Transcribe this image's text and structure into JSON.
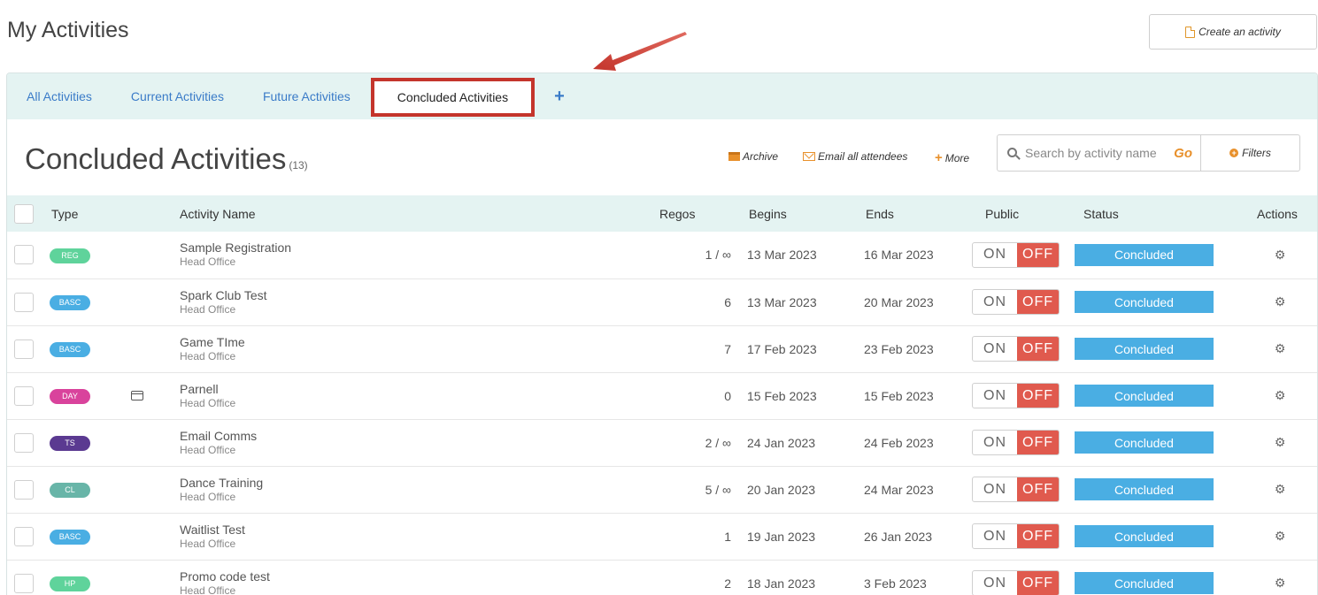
{
  "page": {
    "title": "My Activities"
  },
  "create_button": {
    "label": "Create an activity"
  },
  "tabs": [
    {
      "label": "All Activities"
    },
    {
      "label": "Current Activities"
    },
    {
      "label": "Future Activities"
    },
    {
      "label": "Concluded Activities",
      "active": true
    }
  ],
  "section": {
    "title": "Concluded Activities",
    "count": "(13)"
  },
  "toolbar": {
    "archive": "Archive",
    "email": "Email all attendees",
    "more": "More"
  },
  "search": {
    "placeholder": "Search by activity name",
    "go": "Go",
    "filters": "Filters"
  },
  "table": {
    "headers": {
      "type": "Type",
      "name": "Activity Name",
      "regos": "Regos",
      "begins": "Begins",
      "ends": "Ends",
      "public": "Public",
      "status": "Status",
      "actions": "Actions"
    },
    "rows": [
      {
        "type": "REG",
        "type_color": "#5fd39b",
        "card": false,
        "name": "Sample Registration",
        "location": "Head Office",
        "regos": "1 / ∞",
        "begins": "13 Mar 2023",
        "ends": "16 Mar 2023",
        "on": "ON",
        "off": "OFF",
        "status": "Concluded"
      },
      {
        "type": "BASC",
        "type_color": "#4aaee3",
        "card": false,
        "name": "Spark Club Test",
        "location": "Head Office",
        "regos": "6",
        "begins": "13 Mar 2023",
        "ends": "20 Mar 2023",
        "on": "ON",
        "off": "OFF",
        "status": "Concluded"
      },
      {
        "type": "BASC",
        "type_color": "#4aaee3",
        "card": false,
        "name": "Game TIme",
        "location": "Head Office",
        "regos": "7",
        "begins": "17 Feb 2023",
        "ends": "23 Feb 2023",
        "on": "ON",
        "off": "OFF",
        "status": "Concluded"
      },
      {
        "type": "DAY",
        "type_color": "#d9439c",
        "card": true,
        "name": "Parnell",
        "location": "Head Office",
        "regos": "0",
        "begins": "15 Feb 2023",
        "ends": "15 Feb 2023",
        "on": "ON",
        "off": "OFF",
        "status": "Concluded"
      },
      {
        "type": "TS",
        "type_color": "#5b3a91",
        "card": false,
        "name": "Email Comms",
        "location": "Head Office",
        "regos": "2 / ∞",
        "begins": "24 Jan 2023",
        "ends": "24 Feb 2023",
        "on": "ON",
        "off": "OFF",
        "status": "Concluded"
      },
      {
        "type": "CL",
        "type_color": "#68b5a8",
        "card": false,
        "name": "Dance Training",
        "location": "Head Office",
        "regos": "5 / ∞",
        "begins": "20 Jan 2023",
        "ends": "24 Mar 2023",
        "on": "ON",
        "off": "OFF",
        "status": "Concluded"
      },
      {
        "type": "BASC",
        "type_color": "#4aaee3",
        "card": false,
        "name": "Waitlist Test",
        "location": "Head Office",
        "regos": "1",
        "begins": "19 Jan 2023",
        "ends": "26 Jan 2023",
        "on": "ON",
        "off": "OFF",
        "status": "Concluded"
      },
      {
        "type": "HP",
        "type_color": "#5fd39b",
        "card": false,
        "name": "Promo code test",
        "location": "Head Office",
        "regos": "2",
        "begins": "18 Jan 2023",
        "ends": "3 Feb 2023",
        "on": "ON",
        "off": "OFF",
        "status": "Concluded"
      }
    ]
  },
  "icons": {
    "create": "document-icon",
    "archive": "archive-icon",
    "email": "envelope-icon",
    "more": "plus-icon",
    "search": "search-icon",
    "filters": "plus-circle-icon",
    "actions": "gear-icon",
    "card": "credit-card-icon"
  },
  "colors": {
    "accent": "#e8902b",
    "link": "#3a7bc8",
    "tab_bar": "#e4f3f2",
    "highlight": "#c4352c",
    "off": "#e05a4e",
    "status": "#4aaee3"
  }
}
